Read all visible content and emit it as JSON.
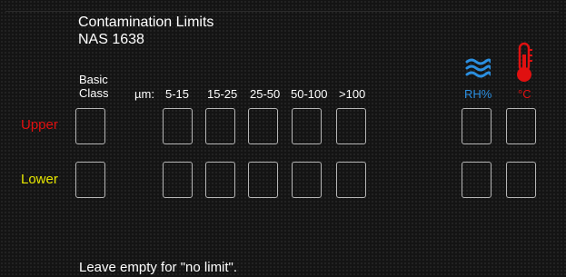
{
  "header": {
    "title": "Contamination Limits",
    "subtitle": "NAS 1638"
  },
  "columns": {
    "basic_class_line1": "Basic",
    "basic_class_line2": "Class",
    "micron_label": "µm:",
    "ranges": [
      "5-15",
      "15-25",
      "25-50",
      "50-100",
      ">100"
    ],
    "humidity": "RH%",
    "temperature": "°C"
  },
  "rows": {
    "upper": "Upper",
    "lower": "Lower"
  },
  "fields": {
    "upper": {
      "basic_class": "",
      "r5_15": "",
      "r15_25": "",
      "r25_50": "",
      "r50_100": "",
      "r100": "",
      "rh": "",
      "temp": ""
    },
    "lower": {
      "basic_class": "",
      "r5_15": "",
      "r15_25": "",
      "r25_50": "",
      "r50_100": "",
      "r100": "",
      "rh": "",
      "temp": ""
    }
  },
  "icons": {
    "humidity": "humidity-waves-icon",
    "temperature": "thermometer-icon"
  },
  "colors": {
    "upper": "#e01010",
    "lower": "#e6e600",
    "humidity": "#2b8fe0",
    "temperature": "#e01010"
  },
  "footer": {
    "note": "Leave empty for \"no limit\"."
  }
}
